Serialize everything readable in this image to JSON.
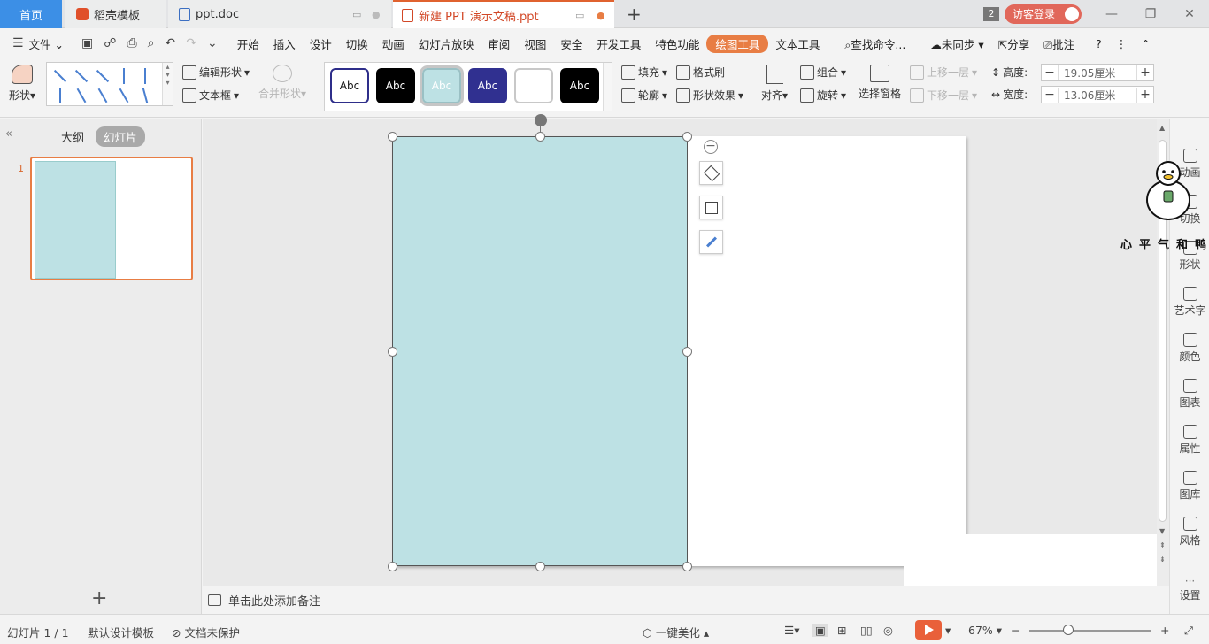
{
  "tabs": {
    "home": "首页",
    "daoke": "稻壳模板",
    "doc": "ppt.doc",
    "ppt": "新建 PPT 演示文稿.ppt",
    "add": "+"
  },
  "titlebar": {
    "window_count": "2",
    "login": "访客登录",
    "minimize": "—",
    "restore": "❐",
    "close": "✕"
  },
  "menu": {
    "file": "文件",
    "items": [
      "开始",
      "插入",
      "设计",
      "切换",
      "动画",
      "幻灯片放映",
      "审阅",
      "视图",
      "安全",
      "开发工具",
      "特色功能",
      "绘图工具",
      "文本工具"
    ],
    "active": "绘图工具",
    "search": "查找命令...",
    "sync": "未同步",
    "share": "分享",
    "comment": "批注",
    "help": "?"
  },
  "ribbon": {
    "shape": "形状",
    "edit_shape": "编辑形状",
    "textbox": "文本框",
    "merge_shape": "合并形状",
    "style_tiles": [
      {
        "label": "Abc",
        "bg": "#ffffff",
        "fg": "#111111",
        "border": "#2e2e8a"
      },
      {
        "label": "Abc",
        "bg": "#000000",
        "fg": "#ffffff",
        "border": "#000000"
      },
      {
        "label": "Abc",
        "bg": "#bde1e4",
        "fg": "#ffffff",
        "border": "#9ac0c4"
      },
      {
        "label": "Abc",
        "bg": "#303090",
        "fg": "#ffffff",
        "border": "#303090"
      },
      {
        "label": "",
        "bg": "#ffffff",
        "fg": "#111111",
        "border": "#c8c8c8"
      },
      {
        "label": "Abc",
        "bg": "#000000",
        "fg": "#ffffff",
        "border": "#000000"
      }
    ],
    "fill": "填充",
    "format_painter": "格式刷",
    "outline": "轮廓",
    "shape_effect": "形状效果",
    "align": "对齐",
    "group": "组合",
    "rotate": "旋转",
    "selection_pane": "选择窗格",
    "bring_forward": "上移一层",
    "send_backward": "下移一层",
    "height_label": "高度:",
    "height_value": "19.05厘米",
    "width_label": "宽度:",
    "width_value": "13.06厘米"
  },
  "leftpane": {
    "outline": "大纲",
    "slides": "幻灯片",
    "slide_number": "1",
    "add": "+"
  },
  "notes": {
    "placeholder": "单击此处添加备注"
  },
  "rightpanel": {
    "items": [
      "动画",
      "切换",
      "形状",
      "艺术字",
      "颜色",
      "图表",
      "属性",
      "图库",
      "风格",
      "设置"
    ]
  },
  "sticker": {
    "text": "心平气和鸭"
  },
  "status": {
    "slide_counter": "幻灯片 1 / 1",
    "template": "默认设计模板",
    "protection": "文档未保护",
    "beautify": "一键美化",
    "zoom": "67%",
    "zoom_out": "−",
    "zoom_in": "+"
  },
  "colors": {
    "accent": "#e87d44",
    "shape_fill": "#bde1e4",
    "home_tab": "#3c8fe6",
    "login": "#e1675a"
  }
}
